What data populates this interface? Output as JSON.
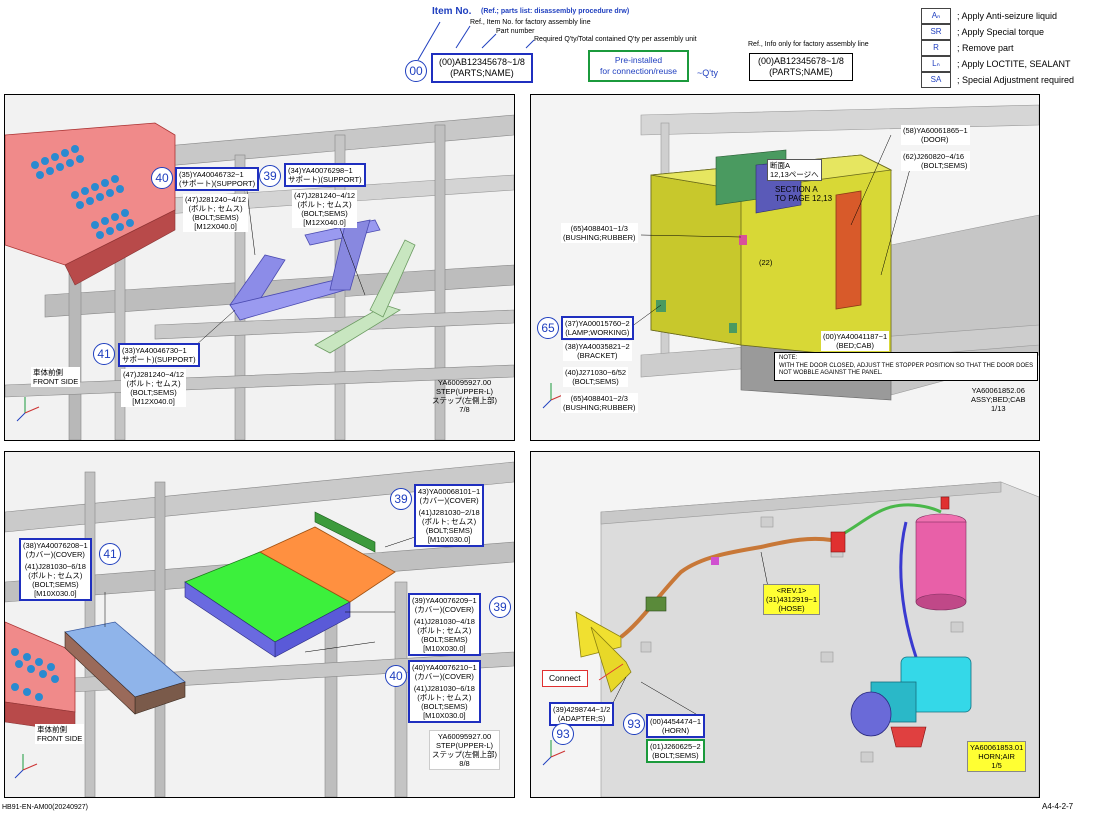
{
  "header": {
    "item_no_title": "Item No.",
    "item_no_sub": "(Ref.; parts list: disassembly procedure drw)",
    "ref_item_no": "Ref., Item No. for factory assembly line",
    "part_number": "Part number",
    "required_qty": "Required Q'ty/Total contained Q'ty per assembly unit",
    "sample_num": "00",
    "sample_line1": "(00)AB12345678~1/8",
    "sample_line2": "(PARTS;NAME)",
    "preinstalled_line1": "Pre-installed",
    "preinstalled_line2": "for connection/reuse",
    "qty_mark": "~Q'ty",
    "ref_info": "Ref., Info only for factory assembly line",
    "ref_line1": "(00)AB12345678~1/8",
    "ref_line2": "(PARTS;NAME)"
  },
  "legend": [
    {
      "code": "Aₙ",
      "text": "; Apply Anti-seizure liquid"
    },
    {
      "code": "SR",
      "text": "; Apply Special torque"
    },
    {
      "code": "R",
      "text": "; Remove part"
    },
    {
      "code": "Lₙ",
      "text": "; Apply LOCTITE, SEALANT"
    },
    {
      "code": "SA",
      "text": "; Special Adjustment required"
    }
  ],
  "panel1": {
    "c40": "40",
    "l40": [
      "(35)YA40046732~1",
      "(サポート)(SUPPORT)"
    ],
    "l40b": [
      "(47)J281240~4/12",
      "(ボルト; セムス)",
      "(BOLT;SEMS)",
      "[M12X040.0]"
    ],
    "c39": "39",
    "l39": [
      "(34)YA40076298~1",
      "サポート)(SUPPORT)"
    ],
    "l39b": [
      "(47)J281240~4/12",
      "(ボルト; セムス)",
      "(BOLT;SEMS)",
      "[M12X040.0]"
    ],
    "c41": "41",
    "l41": [
      "(33)YA40046730~1",
      "サポート)(SUPPORT)"
    ],
    "l41b": [
      "(47)J281240~4/12",
      "(ボルト; セムス)",
      "(BOLT;SEMS)",
      "[M12X040.0]"
    ],
    "front_jp": "車体前側",
    "front_en": "FRONT SIDE",
    "title": [
      "YA60095927.00",
      "STEP(UPPER-L)",
      "ステップ(左側上部)",
      "7/8"
    ]
  },
  "panel2": {
    "door": [
      "(58)YA60061865~1",
      "(DOOR)"
    ],
    "bolt62": [
      "(62)J260820~4/16",
      "(BOLT;SEMS)"
    ],
    "section_jp": [
      "断面A",
      "12,13ページへ"
    ],
    "section_en": [
      "SECTION A",
      "TO PAGE 12,13"
    ],
    "bushing65": [
      "(65)4088401~1/3",
      "(BUSHING;RUBBER)"
    ],
    "num22": "(22)",
    "c65": "65",
    "lamp": [
      "(37)YA00015760~2",
      "(LAMP;WORKING)"
    ],
    "bracket": [
      "(38)YA40035821~2",
      "(BRACKET)"
    ],
    "bolt40": [
      "(40)J271030~6/52",
      "(BOLT;SEMS)"
    ],
    "bushing65b": [
      "(65)4088401~2/3",
      "(BUSHING;RUBBER)"
    ],
    "bedcab": [
      "(00)YA40041187~1",
      "(BED;CAB)"
    ],
    "note_title": "NOTE:",
    "note_text": [
      "WITH THE DOOR CLOSED, ADJUST THE STOPPER POSITION SO THAT THE DOOR DOES",
      "NOT WOBBLE AGAINST THE PANEL."
    ],
    "title": [
      "YA60061852.06",
      "ASSY;BED;CAB",
      "1/13"
    ]
  },
  "panel3": {
    "c39": "39",
    "l39top": [
      "43)YA00068101~1",
      "(カバー)(COVER)"
    ],
    "l39topb": [
      "(41)J281030~2/18",
      "(ボルト; セムス)",
      "(BOLT;SEMS)",
      "[M10X030.0]"
    ],
    "c41": "41",
    "l41": [
      "(38)YA40076208~1",
      "(カバー)(COVER)"
    ],
    "l41b": [
      "(41)J281030~6/18",
      "(ボルト; セムス)",
      "(BOLT;SEMS)",
      "[M10X030.0]"
    ],
    "c39b": "39",
    "l39b": [
      "(39)YA40076209~1",
      "(カバー)(COVER)"
    ],
    "l39bb": [
      "(41)J281030~4/18",
      "(ボルト; セムス)",
      "(BOLT;SEMS)",
      "[M10X030.0]"
    ],
    "c40": "40",
    "l40": [
      "(40)YA40076210~1",
      "(カバー)(COVER)"
    ],
    "l40b": [
      "(41)J281030~6/18",
      "(ボルト; セムス)",
      "(BOLT;SEMS)",
      "[M10X030.0]"
    ],
    "front_jp": "車体前側",
    "front_en": "FRONT SIDE",
    "title": [
      "YA60095927.00",
      "STEP(UPPER-L)",
      "ステップ(左側上部)",
      "8/8"
    ]
  },
  "panel4": {
    "hose": [
      "<REV.1>",
      "(31)4312919~1",
      "(HOSE)"
    ],
    "connect": "Connect",
    "adapter": [
      "(39)4298744~1/2",
      "(ADAPTER;S)"
    ],
    "c93a": "93",
    "c93b": "93",
    "horn": [
      "(00)4454474~1",
      "(HORN)"
    ],
    "bolt01": [
      "(01)J260625~2",
      "(BOLT;SEMS)"
    ],
    "title": [
      "YA60061853.01",
      "HORN;AIR",
      "1/5"
    ]
  },
  "footer": {
    "left": "HB91-EN-AM00(20240927)",
    "right": "A4-4-2-7"
  }
}
